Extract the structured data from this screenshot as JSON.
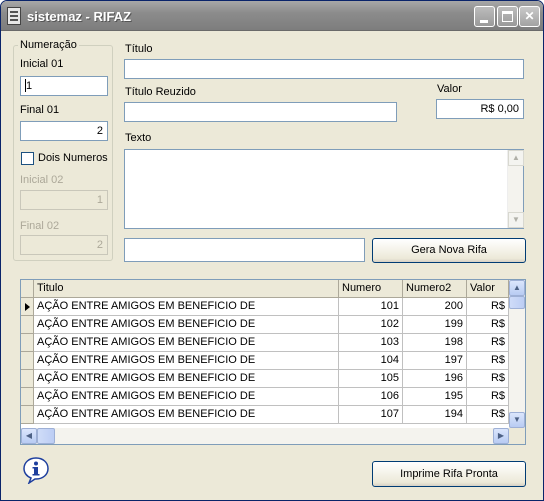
{
  "window": {
    "title": "sistemaz - RIFAZ"
  },
  "numeracao": {
    "group_label": "Numeração",
    "inicial01_label": "Inicial 01",
    "inicial01_value": "1",
    "final01_label": "Final 01",
    "final01_value": "2",
    "dois_numeros_label": "Dois Numeros",
    "dois_numeros_checked": false,
    "inicial02_label": "Inicial 02",
    "inicial02_value": "1",
    "final02_label": "Final 02",
    "final02_value": "2"
  },
  "form": {
    "titulo_label": "Título",
    "titulo_value": "",
    "titulo_reduzido_label": "Título Reuzido",
    "titulo_reduzido_value": "",
    "valor_label": "Valor",
    "valor_value": "R$ 0,00",
    "texto_label": "Texto",
    "texto_value": "",
    "status_value": "",
    "gera_button": "Gera Nova Rifa"
  },
  "grid": {
    "columns": [
      "Titulo",
      "Numero",
      "Numero2",
      "Valor"
    ],
    "rows": [
      {
        "titulo": "AÇÃO ENTRE AMIGOS EM BENEFICIO DE",
        "numero": "101",
        "numero2": "200",
        "valor": "R$"
      },
      {
        "titulo": "AÇÃO ENTRE AMIGOS EM BENEFICIO DE",
        "numero": "102",
        "numero2": "199",
        "valor": "R$"
      },
      {
        "titulo": "AÇÃO ENTRE AMIGOS EM BENEFICIO DE",
        "numero": "103",
        "numero2": "198",
        "valor": "R$"
      },
      {
        "titulo": "AÇÃO ENTRE AMIGOS EM BENEFICIO DE",
        "numero": "104",
        "numero2": "197",
        "valor": "R$"
      },
      {
        "titulo": "AÇÃO ENTRE AMIGOS EM BENEFICIO DE",
        "numero": "105",
        "numero2": "196",
        "valor": "R$"
      },
      {
        "titulo": "AÇÃO ENTRE AMIGOS EM BENEFICIO DE",
        "numero": "106",
        "numero2": "195",
        "valor": "R$"
      },
      {
        "titulo": "AÇÃO ENTRE AMIGOS EM BENEFICIO DE",
        "numero": "107",
        "numero2": "194",
        "valor": "R$"
      }
    ]
  },
  "footer": {
    "imprime_button": "Imprime Rifa Pronta"
  },
  "icons": {
    "app": "notepad-icon",
    "info": "info-icon",
    "row_selected": "row-pointer-icon"
  },
  "colors": {
    "titlebar": "#8c8c8c",
    "window_bg": "#ece9d8",
    "input_border": "#7f9db9",
    "info_blue": "#1e3f9e"
  }
}
